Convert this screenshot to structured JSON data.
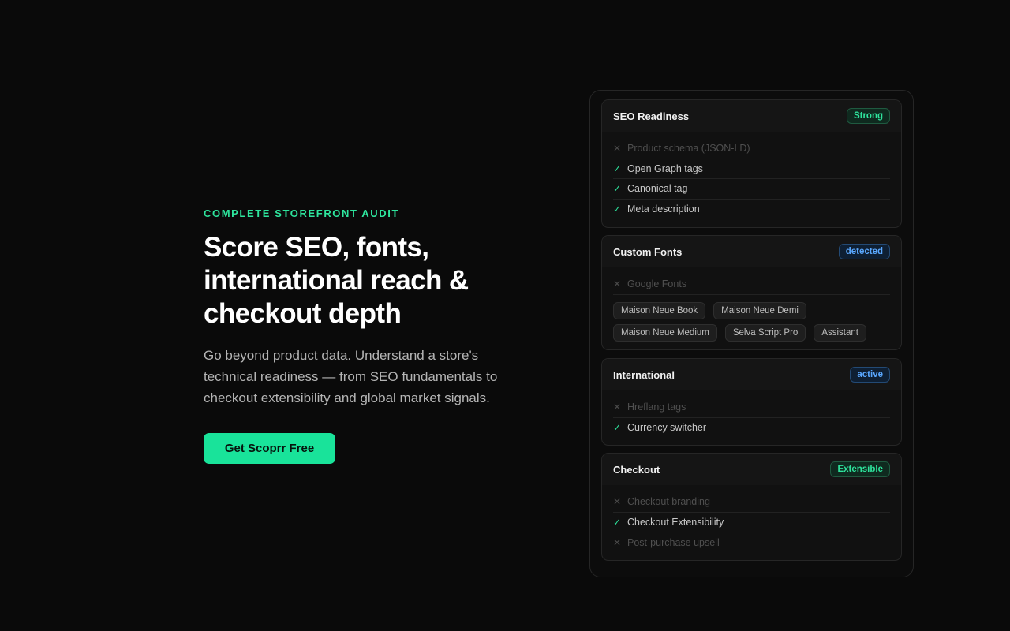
{
  "hero": {
    "eyebrow": "COMPLETE STOREFRONT AUDIT",
    "headline": [
      "Score SEO, fonts,",
      "international reach &",
      "checkout depth"
    ],
    "subcopy": [
      "Go beyond product data. Understand a store's",
      "technical readiness — from SEO fundamentals to",
      "checkout extensibility and global market signals."
    ],
    "cta": "Get Scoprr Free"
  },
  "colors": {
    "accent": "#19e39a",
    "badge_green": "#2ee59d",
    "badge_blue": "#5aa8ff"
  },
  "cards": {
    "seo": {
      "title": "SEO Readiness",
      "badge": "Strong",
      "items": [
        {
          "label": "Product schema (JSON-LD)",
          "status": "missing",
          "icon": "cross-icon"
        },
        {
          "label": "Open Graph tags",
          "status": "present",
          "icon": "check-icon"
        },
        {
          "label": "Canonical tag",
          "status": "present",
          "icon": "check-icon"
        },
        {
          "label": "Meta description",
          "status": "present",
          "icon": "check-icon"
        }
      ]
    },
    "fonts": {
      "title": "Custom Fonts",
      "badge": "detected",
      "items": [
        {
          "label": "Google Fonts",
          "status": "missing",
          "icon": "cross-icon"
        }
      ],
      "chips": [
        "Maison Neue Book",
        "Maison Neue Demi",
        "Maison Neue Medium",
        "Selva Script Pro",
        "Assistant"
      ]
    },
    "intl": {
      "title": "International",
      "badge": "active",
      "items": [
        {
          "label": "Hreflang tags",
          "status": "missing",
          "icon": "cross-icon"
        },
        {
          "label": "Currency switcher",
          "status": "present",
          "icon": "check-icon"
        }
      ]
    },
    "checkout": {
      "title": "Checkout",
      "badge": "Extensible",
      "items": [
        {
          "label": "Checkout branding",
          "status": "missing",
          "icon": "cross-icon"
        },
        {
          "label": "Checkout Extensibility",
          "status": "present",
          "icon": "check-icon"
        },
        {
          "label": "Post-purchase upsell",
          "status": "missing",
          "icon": "cross-icon"
        }
      ]
    }
  }
}
